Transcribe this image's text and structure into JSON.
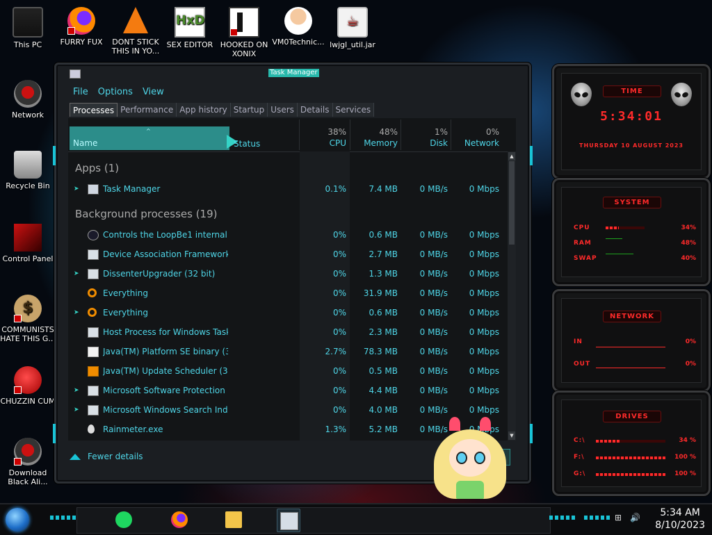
{
  "desktop": {
    "icons": [
      {
        "label": "This PC"
      },
      {
        "label": "FURRY FUX"
      },
      {
        "label": "DONT STICK THIS IN YO..."
      },
      {
        "label": "SEX EDITOR"
      },
      {
        "label": "HOOKED ON XONIX"
      },
      {
        "label": "VM0Technic..."
      },
      {
        "label": "lwjgl_util.jar"
      },
      {
        "label": "Network"
      },
      {
        "label": "Recycle Bin"
      },
      {
        "label": "Control Panel"
      },
      {
        "label": "COMMUNISTS HATE THIS G..."
      },
      {
        "label": "CHUZZIN CUM"
      },
      {
        "label": "Download Black Ali..."
      }
    ]
  },
  "taskmgr": {
    "title": "Task Manager",
    "menu": [
      "File",
      "Options",
      "View"
    ],
    "tabs": [
      "Processes",
      "Performance",
      "App history",
      "Startup",
      "Users",
      "Details",
      "Services"
    ],
    "active_tab": "Processes",
    "columns": {
      "name": "Name",
      "status": "Status",
      "cpu": {
        "pct": "38%",
        "label": "CPU"
      },
      "memory": {
        "pct": "48%",
        "label": "Memory"
      },
      "disk": {
        "pct": "1%",
        "label": "Disk"
      },
      "network": {
        "pct": "0%",
        "label": "Network"
      }
    },
    "groups": {
      "apps": "Apps (1)",
      "background": "Background processes (19)"
    },
    "apps": [
      {
        "name": "Task Manager",
        "cpu": "0.1%",
        "memory": "7.4 MB",
        "disk": "0 MB/s",
        "network": "0 Mbps",
        "expandable": true,
        "icon": "task-manager-icon"
      }
    ],
    "background": [
      {
        "name": "Controls the LoopBe1 internal ...",
        "cpu": "0%",
        "memory": "0.6 MB",
        "disk": "0 MB/s",
        "network": "0 Mbps",
        "expandable": false,
        "icon": "loopbe-icon"
      },
      {
        "name": "Device Association Framework ...",
        "cpu": "0%",
        "memory": "2.7 MB",
        "disk": "0 MB/s",
        "network": "0 Mbps",
        "expandable": false,
        "icon": "window-icon"
      },
      {
        "name": "DissenterUpgrader (32 bit)",
        "cpu": "0%",
        "memory": "1.3 MB",
        "disk": "0 MB/s",
        "network": "0 Mbps",
        "expandable": true,
        "icon": "window-icon"
      },
      {
        "name": "Everything",
        "cpu": "0%",
        "memory": "31.9 MB",
        "disk": "0 MB/s",
        "network": "0 Mbps",
        "expandable": false,
        "icon": "search-icon"
      },
      {
        "name": "Everything",
        "cpu": "0%",
        "memory": "0.6 MB",
        "disk": "0 MB/s",
        "network": "0 Mbps",
        "expandable": true,
        "icon": "search-icon"
      },
      {
        "name": "Host Process for Windows Tasks",
        "cpu": "0%",
        "memory": "2.3 MB",
        "disk": "0 MB/s",
        "network": "0 Mbps",
        "expandable": false,
        "icon": "window-icon"
      },
      {
        "name": "Java(TM) Platform SE binary (32...",
        "cpu": "2.7%",
        "memory": "78.3 MB",
        "disk": "0 MB/s",
        "network": "0 Mbps",
        "expandable": false,
        "icon": "java-icon"
      },
      {
        "name": "Java(TM) Update Scheduler (32 ...",
        "cpu": "0%",
        "memory": "0.5 MB",
        "disk": "0 MB/s",
        "network": "0 Mbps",
        "expandable": false,
        "icon": "java-update-icon"
      },
      {
        "name": "Microsoft Software Protection P...",
        "cpu": "0%",
        "memory": "4.4 MB",
        "disk": "0 MB/s",
        "network": "0 Mbps",
        "expandable": true,
        "icon": "window-icon"
      },
      {
        "name": "Microsoft Windows Search Inde...",
        "cpu": "0%",
        "memory": "4.0 MB",
        "disk": "0 MB/s",
        "network": "0 Mbps",
        "expandable": true,
        "icon": "window-icon"
      },
      {
        "name": "Rainmeter.exe",
        "cpu": "1.3%",
        "memory": "5.2 MB",
        "disk": "0 MB/s",
        "network": "0 Mbps",
        "expandable": false,
        "icon": "droplet-icon"
      }
    ],
    "footer": {
      "fewer_details": "Fewer details"
    }
  },
  "rainmeter": {
    "time": {
      "title": "TIME",
      "clock": "5:34:01",
      "date": "THURSDAY 10 AUGUST 2023"
    },
    "system": {
      "title": "SYSTEM",
      "cpu_label": "CPU",
      "cpu_value": "34%",
      "cpu_fraction": 0.34,
      "ram_label": "RAM",
      "ram_value": "48%",
      "ram_fraction": 0.48,
      "swap_label": "SWAP",
      "swap_value": "40%",
      "swap_fraction": 0.4
    },
    "network": {
      "title": "NETWORK",
      "in_label": "IN",
      "in_value": "0%",
      "out_label": "OUT",
      "out_value": "0%"
    },
    "drives": {
      "title": "DRIVES",
      "rows": [
        {
          "label": "C:\\",
          "value": "34 %",
          "fraction": 0.34
        },
        {
          "label": "F:\\",
          "value": "100 %",
          "fraction": 1.0
        },
        {
          "label": "G:\\",
          "value": "100 %",
          "fraction": 1.0
        }
      ]
    }
  },
  "taskbar": {
    "time": "5:34 AM",
    "date": "8/10/2023"
  },
  "colors": {
    "accent_cyan": "#19c3d6",
    "text_cyan": "#4fd6e8",
    "rainmeter_red": "#ff2a2a"
  }
}
